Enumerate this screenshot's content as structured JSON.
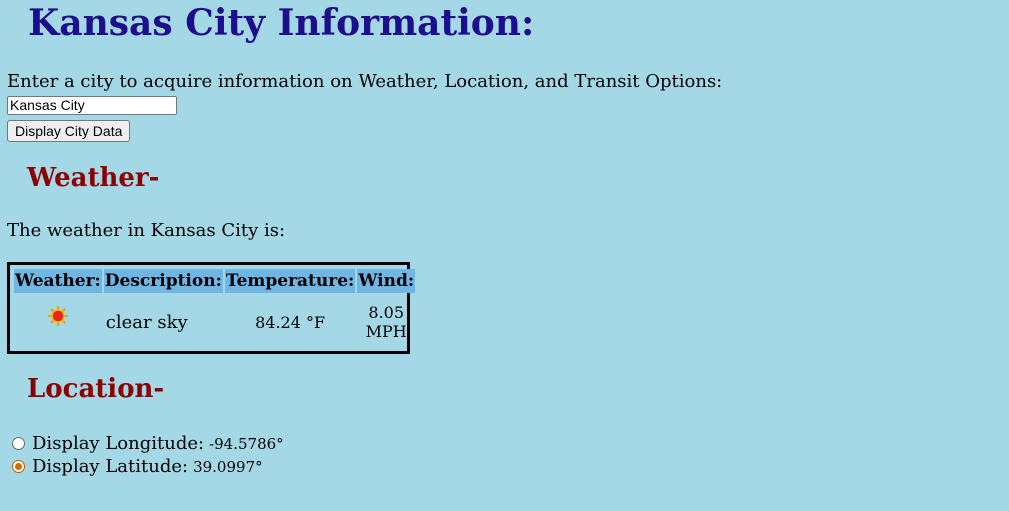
{
  "page_title": "Kansas City Information:",
  "prompt": "Enter a city to acquire information on Weather, Location, and Transit Options:",
  "city_input": {
    "value": "Kansas City"
  },
  "display_button": "Display City Data",
  "weather": {
    "heading": "Weather-",
    "summary": "The weather in Kansas City is:",
    "headers": [
      "Weather:",
      "Description:",
      "Temperature:",
      "Wind:"
    ],
    "icon": "sun-icon",
    "description": "clear sky",
    "temperature": "84.24 °F",
    "wind": "8.05 MPH"
  },
  "location": {
    "heading": "Location-",
    "longitude_label": "Display Longitude:",
    "longitude_value": "-94.5786°",
    "latitude_label": "Display Latitude:",
    "latitude_value": "39.0997°",
    "selected": "latitude"
  },
  "colors": {
    "background": "#a5d8e6",
    "title": "#1c0e8c",
    "section_heading": "#8b0000",
    "table_header": "#70b6e4"
  }
}
